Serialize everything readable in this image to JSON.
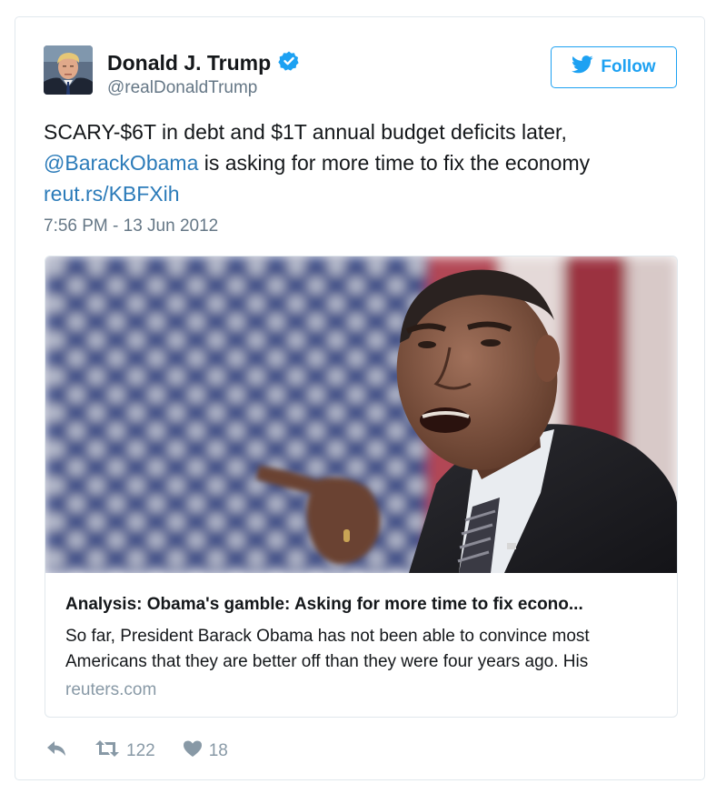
{
  "user": {
    "name": "Donald J. Trump",
    "handle": "@realDonaldTrump",
    "verified": true
  },
  "follow_button": {
    "label": "Follow",
    "icon": "twitter-bird-icon"
  },
  "tweet": {
    "text_part1": "SCARY-$6T in debt and $1T annual budget deficits later,",
    "mention": "@BarackObama",
    "text_part2": " is asking for more time to fix the economy",
    "link": "reut.rs/KBFXih",
    "timestamp": "7:56 PM - 13 Jun 2012"
  },
  "link_card": {
    "title": "Analysis: Obama's gamble: Asking for more time to fix econo...",
    "description": "So far, President Barack Obama has not been able to convince most Americans that they are better off than they were four years ago. His",
    "domain": "reuters.com"
  },
  "actions": {
    "retweets": "122",
    "likes": "18"
  },
  "colors": {
    "accent": "#1da1f2",
    "link": "#2b7bb9",
    "muted": "#657786",
    "icon_gray": "#8899a6"
  }
}
